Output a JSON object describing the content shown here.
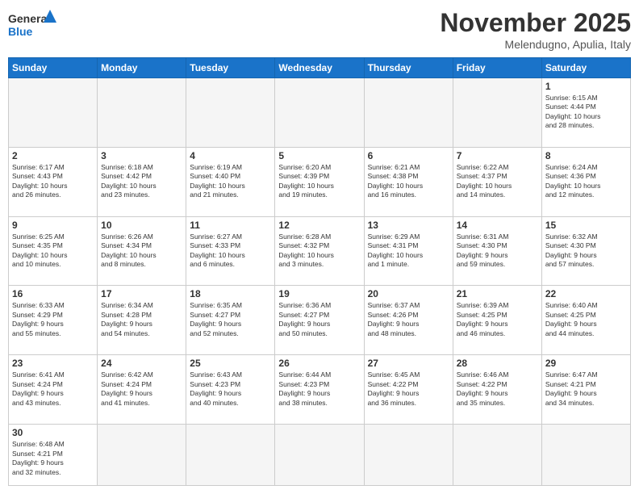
{
  "header": {
    "logo_general": "General",
    "logo_blue": "Blue",
    "title": "November 2025",
    "location": "Melendugno, Apulia, Italy"
  },
  "weekdays": [
    "Sunday",
    "Monday",
    "Tuesday",
    "Wednesday",
    "Thursday",
    "Friday",
    "Saturday"
  ],
  "weeks": [
    [
      {
        "day": "",
        "info": ""
      },
      {
        "day": "",
        "info": ""
      },
      {
        "day": "",
        "info": ""
      },
      {
        "day": "",
        "info": ""
      },
      {
        "day": "",
        "info": ""
      },
      {
        "day": "",
        "info": ""
      },
      {
        "day": "1",
        "info": "Sunrise: 6:15 AM\nSunset: 4:44 PM\nDaylight: 10 hours\nand 28 minutes."
      }
    ],
    [
      {
        "day": "2",
        "info": "Sunrise: 6:17 AM\nSunset: 4:43 PM\nDaylight: 10 hours\nand 26 minutes."
      },
      {
        "day": "3",
        "info": "Sunrise: 6:18 AM\nSunset: 4:42 PM\nDaylight: 10 hours\nand 23 minutes."
      },
      {
        "day": "4",
        "info": "Sunrise: 6:19 AM\nSunset: 4:40 PM\nDaylight: 10 hours\nand 21 minutes."
      },
      {
        "day": "5",
        "info": "Sunrise: 6:20 AM\nSunset: 4:39 PM\nDaylight: 10 hours\nand 19 minutes."
      },
      {
        "day": "6",
        "info": "Sunrise: 6:21 AM\nSunset: 4:38 PM\nDaylight: 10 hours\nand 16 minutes."
      },
      {
        "day": "7",
        "info": "Sunrise: 6:22 AM\nSunset: 4:37 PM\nDaylight: 10 hours\nand 14 minutes."
      },
      {
        "day": "8",
        "info": "Sunrise: 6:24 AM\nSunset: 4:36 PM\nDaylight: 10 hours\nand 12 minutes."
      }
    ],
    [
      {
        "day": "9",
        "info": "Sunrise: 6:25 AM\nSunset: 4:35 PM\nDaylight: 10 hours\nand 10 minutes."
      },
      {
        "day": "10",
        "info": "Sunrise: 6:26 AM\nSunset: 4:34 PM\nDaylight: 10 hours\nand 8 minutes."
      },
      {
        "day": "11",
        "info": "Sunrise: 6:27 AM\nSunset: 4:33 PM\nDaylight: 10 hours\nand 6 minutes."
      },
      {
        "day": "12",
        "info": "Sunrise: 6:28 AM\nSunset: 4:32 PM\nDaylight: 10 hours\nand 3 minutes."
      },
      {
        "day": "13",
        "info": "Sunrise: 6:29 AM\nSunset: 4:31 PM\nDaylight: 10 hours\nand 1 minute."
      },
      {
        "day": "14",
        "info": "Sunrise: 6:31 AM\nSunset: 4:30 PM\nDaylight: 9 hours\nand 59 minutes."
      },
      {
        "day": "15",
        "info": "Sunrise: 6:32 AM\nSunset: 4:30 PM\nDaylight: 9 hours\nand 57 minutes."
      }
    ],
    [
      {
        "day": "16",
        "info": "Sunrise: 6:33 AM\nSunset: 4:29 PM\nDaylight: 9 hours\nand 55 minutes."
      },
      {
        "day": "17",
        "info": "Sunrise: 6:34 AM\nSunset: 4:28 PM\nDaylight: 9 hours\nand 54 minutes."
      },
      {
        "day": "18",
        "info": "Sunrise: 6:35 AM\nSunset: 4:27 PM\nDaylight: 9 hours\nand 52 minutes."
      },
      {
        "day": "19",
        "info": "Sunrise: 6:36 AM\nSunset: 4:27 PM\nDaylight: 9 hours\nand 50 minutes."
      },
      {
        "day": "20",
        "info": "Sunrise: 6:37 AM\nSunset: 4:26 PM\nDaylight: 9 hours\nand 48 minutes."
      },
      {
        "day": "21",
        "info": "Sunrise: 6:39 AM\nSunset: 4:25 PM\nDaylight: 9 hours\nand 46 minutes."
      },
      {
        "day": "22",
        "info": "Sunrise: 6:40 AM\nSunset: 4:25 PM\nDaylight: 9 hours\nand 44 minutes."
      }
    ],
    [
      {
        "day": "23",
        "info": "Sunrise: 6:41 AM\nSunset: 4:24 PM\nDaylight: 9 hours\nand 43 minutes."
      },
      {
        "day": "24",
        "info": "Sunrise: 6:42 AM\nSunset: 4:24 PM\nDaylight: 9 hours\nand 41 minutes."
      },
      {
        "day": "25",
        "info": "Sunrise: 6:43 AM\nSunset: 4:23 PM\nDaylight: 9 hours\nand 40 minutes."
      },
      {
        "day": "26",
        "info": "Sunrise: 6:44 AM\nSunset: 4:23 PM\nDaylight: 9 hours\nand 38 minutes."
      },
      {
        "day": "27",
        "info": "Sunrise: 6:45 AM\nSunset: 4:22 PM\nDaylight: 9 hours\nand 36 minutes."
      },
      {
        "day": "28",
        "info": "Sunrise: 6:46 AM\nSunset: 4:22 PM\nDaylight: 9 hours\nand 35 minutes."
      },
      {
        "day": "29",
        "info": "Sunrise: 6:47 AM\nSunset: 4:21 PM\nDaylight: 9 hours\nand 34 minutes."
      }
    ],
    [
      {
        "day": "30",
        "info": "Sunrise: 6:48 AM\nSunset: 4:21 PM\nDaylight: 9 hours\nand 32 minutes."
      },
      {
        "day": "",
        "info": ""
      },
      {
        "day": "",
        "info": ""
      },
      {
        "day": "",
        "info": ""
      },
      {
        "day": "",
        "info": ""
      },
      {
        "day": "",
        "info": ""
      },
      {
        "day": "",
        "info": ""
      }
    ]
  ]
}
